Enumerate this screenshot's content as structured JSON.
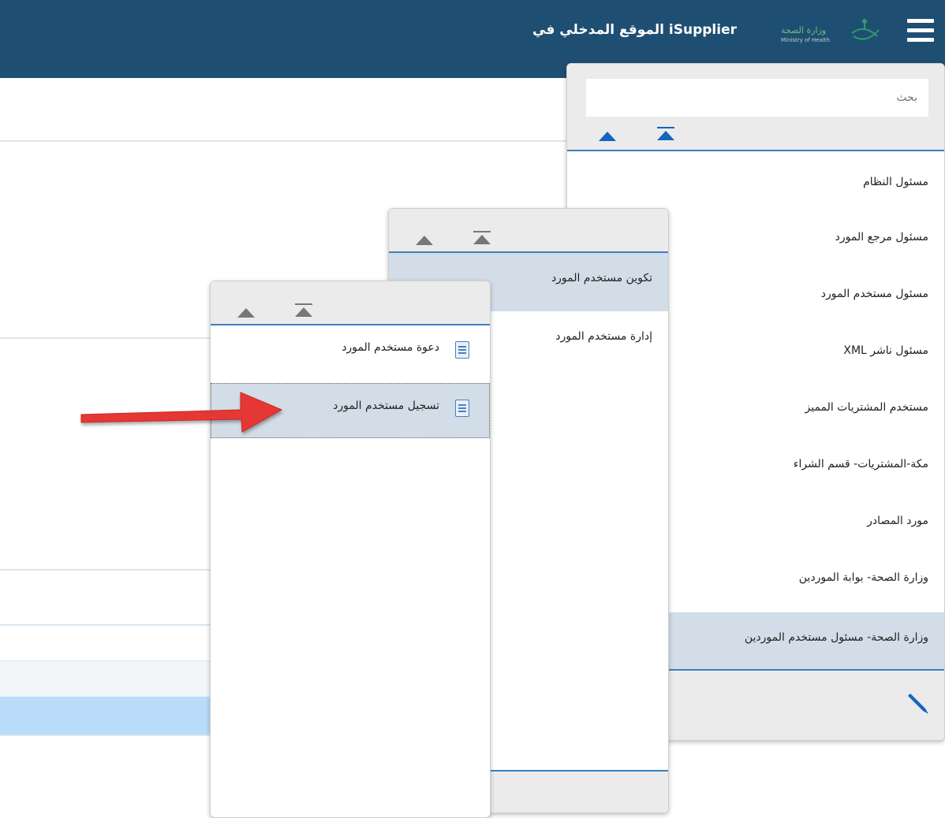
{
  "header": {
    "title": "الموقع المدخلي في iSupplier",
    "logo_text_ar": "وزارة الصحة",
    "logo_text_en": "Ministry of Health"
  },
  "main_menu": {
    "search_placeholder": "بحث",
    "items": [
      {
        "label": "مسئول النظام"
      },
      {
        "label": "مسئول مرجع المورد"
      },
      {
        "label": "مسئول مستخدم المورد"
      },
      {
        "label": "مسئول ناشر XML"
      },
      {
        "label": "مستخدم المشتريات المميز"
      },
      {
        "label": "مكة-المشتريات- قسم الشراء"
      },
      {
        "label": "مورد المصادر"
      },
      {
        "label": "وزارة الصحة- بوابة الموردين"
      },
      {
        "label": "وزارة الصحة- مسئول مستخدم الموردين",
        "selected": true
      }
    ]
  },
  "sub_menu": {
    "items": [
      {
        "label": "تكوين مستخدم المورد",
        "selected": true
      },
      {
        "label": "إدارة مستخدم المورد"
      }
    ]
  },
  "sub_sub_menu": {
    "items": [
      {
        "label": "دعوة مستخدم المورد",
        "icon": "document-icon"
      },
      {
        "label": "تسجيل مستخدم المورد",
        "icon": "document-icon",
        "selected": true
      }
    ]
  },
  "colors": {
    "header_bg": "#1f4e73",
    "accent_blue": "#3b7fc4",
    "selected_bg": "#d3dde7",
    "annotation_arrow": "#e53935"
  }
}
